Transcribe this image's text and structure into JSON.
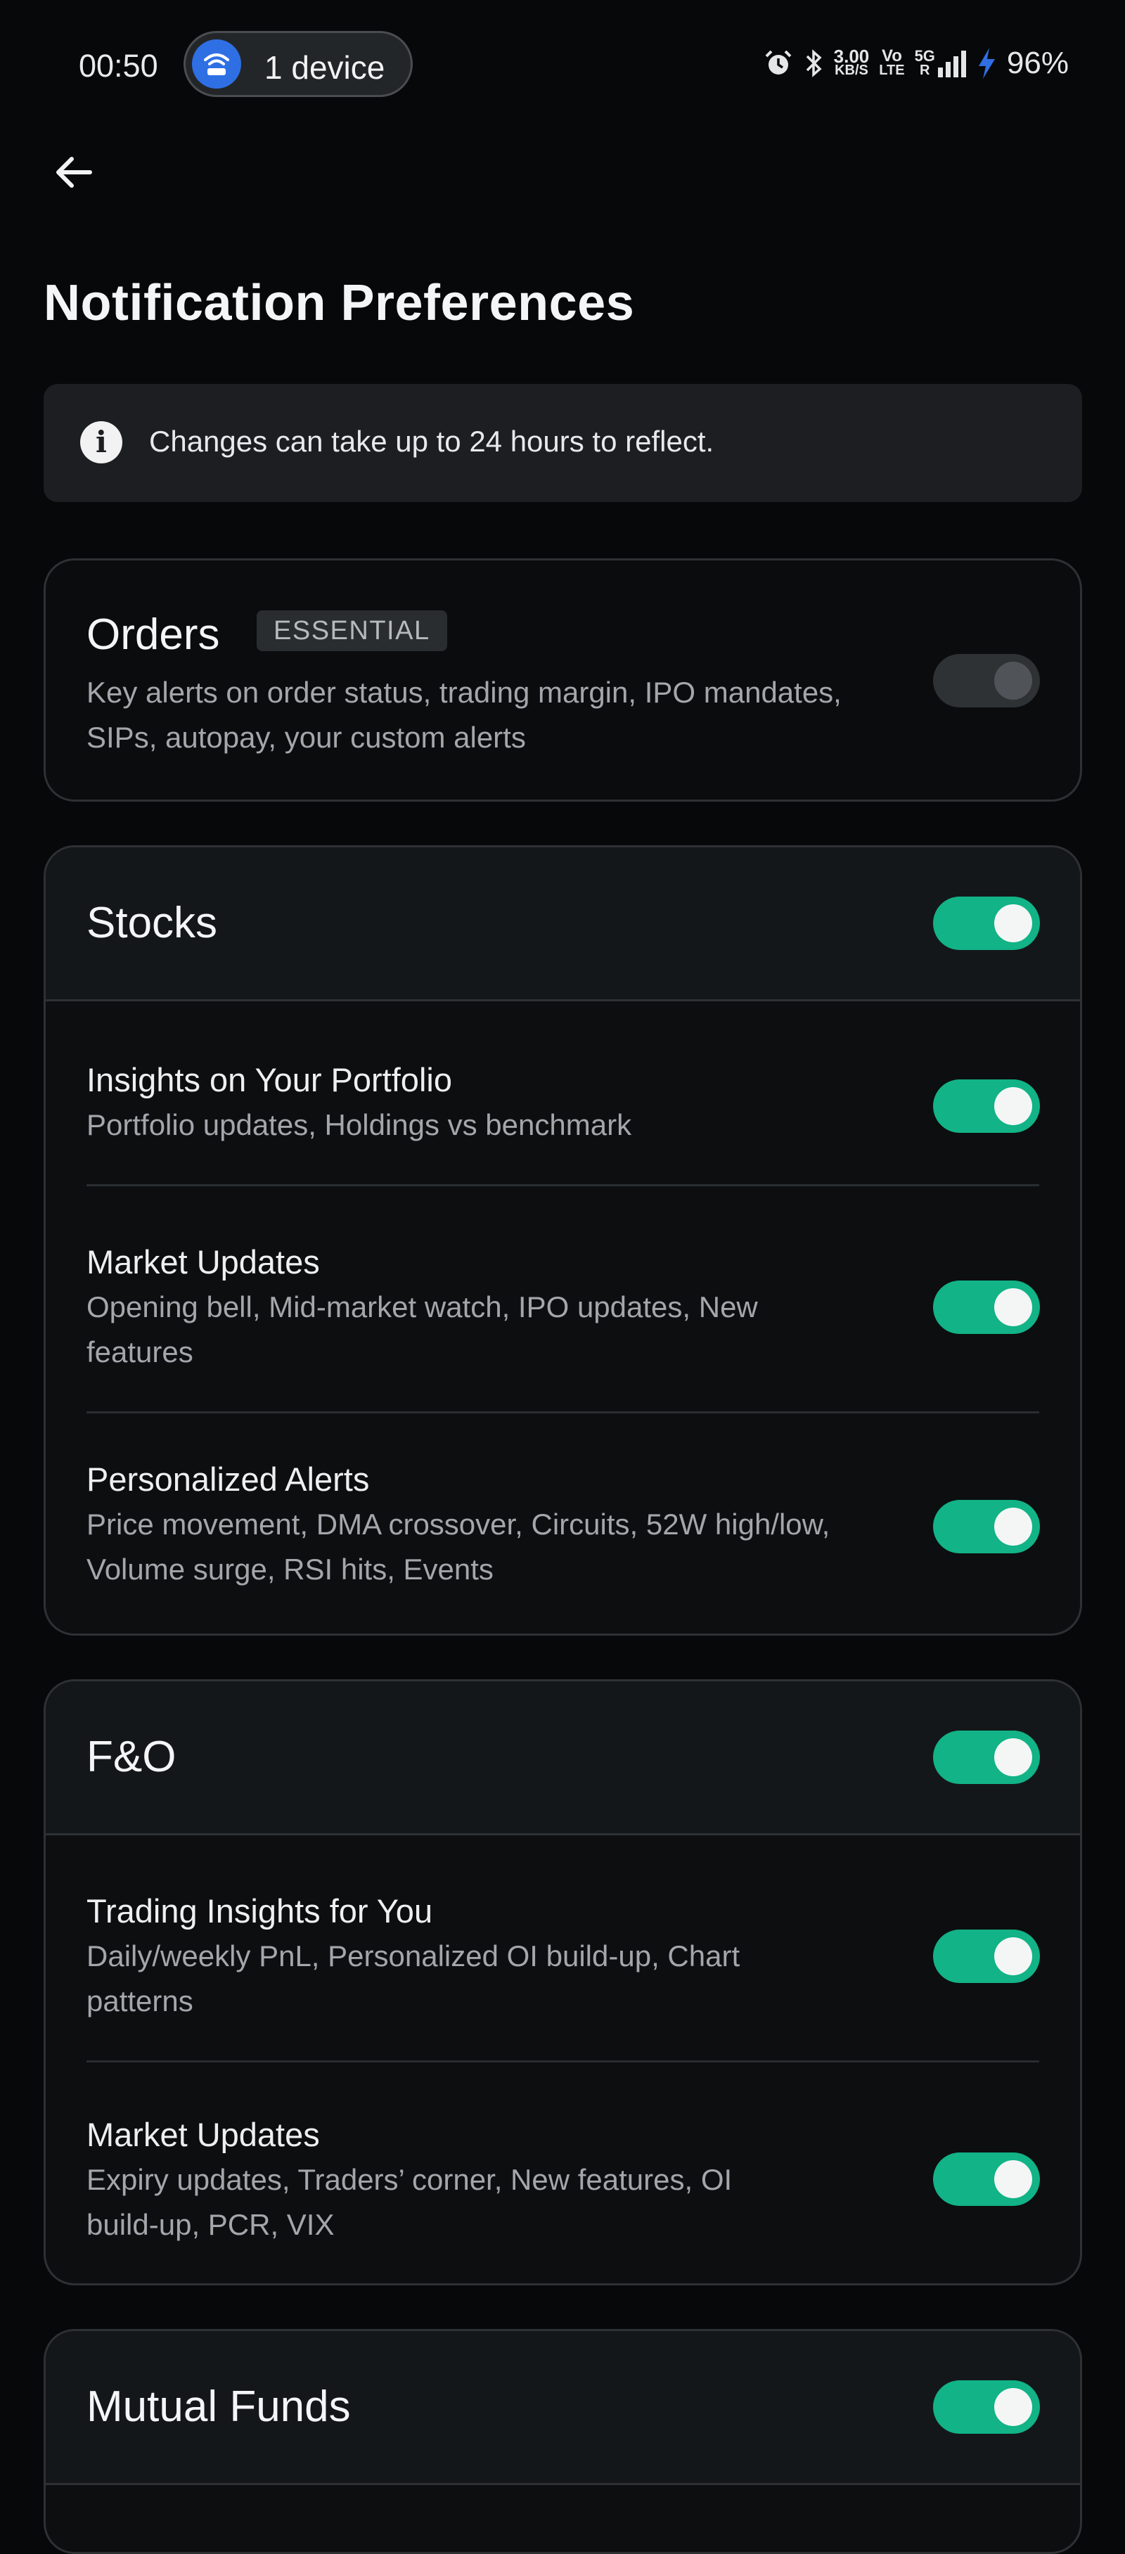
{
  "status_bar": {
    "time": "00:50",
    "device_pill": "1 device",
    "net_speed_top": "3.00",
    "net_speed_bottom": "KB/S",
    "volte_top": "Vo",
    "volte_bottom": "LTE",
    "network_top": "5G",
    "network_bottom": "R",
    "battery": "96%"
  },
  "page": {
    "title": "Notification Preferences"
  },
  "info_banner": {
    "text": "Changes can take up to 24 hours to reflect."
  },
  "orders": {
    "title": "Orders",
    "badge": "ESSENTIAL",
    "description_line1": "Key alerts on order status, trading margin, IPO mandates,",
    "description_line2": "SIPs, autopay, your custom alerts",
    "toggle_on": false
  },
  "stocks": {
    "title": "Stocks",
    "toggle_on": true,
    "items": [
      {
        "title": "Insights on Your Portfolio",
        "line1": "Portfolio updates, Holdings vs benchmark",
        "line2": "",
        "toggle_on": true
      },
      {
        "title": "Market Updates",
        "line1": "Opening bell, Mid-market watch, IPO updates, New",
        "line2": "features",
        "toggle_on": true
      },
      {
        "title": "Personalized Alerts",
        "line1": "Price movement, DMA crossover, Circuits, 52W high/low,",
        "line2": "Volume surge, RSI hits, Events",
        "toggle_on": true
      }
    ]
  },
  "fno": {
    "title": "F&O",
    "toggle_on": true,
    "items": [
      {
        "title": "Trading Insights for You",
        "line1": "Daily/weekly PnL, Personalized OI build-up, Chart",
        "line2": "patterns",
        "toggle_on": true
      },
      {
        "title": "Market Updates",
        "line1": "Expiry updates, Traders’ corner, New features, OI",
        "line2": "build-up, PCR, VIX",
        "toggle_on": true
      }
    ]
  },
  "mutual_funds": {
    "title": "Mutual Funds",
    "toggle_on": true
  },
  "colors": {
    "background": "#070809",
    "toggle_on": "#12b386",
    "toggle_off": "#2f3235",
    "card_border": "#2e3134"
  }
}
